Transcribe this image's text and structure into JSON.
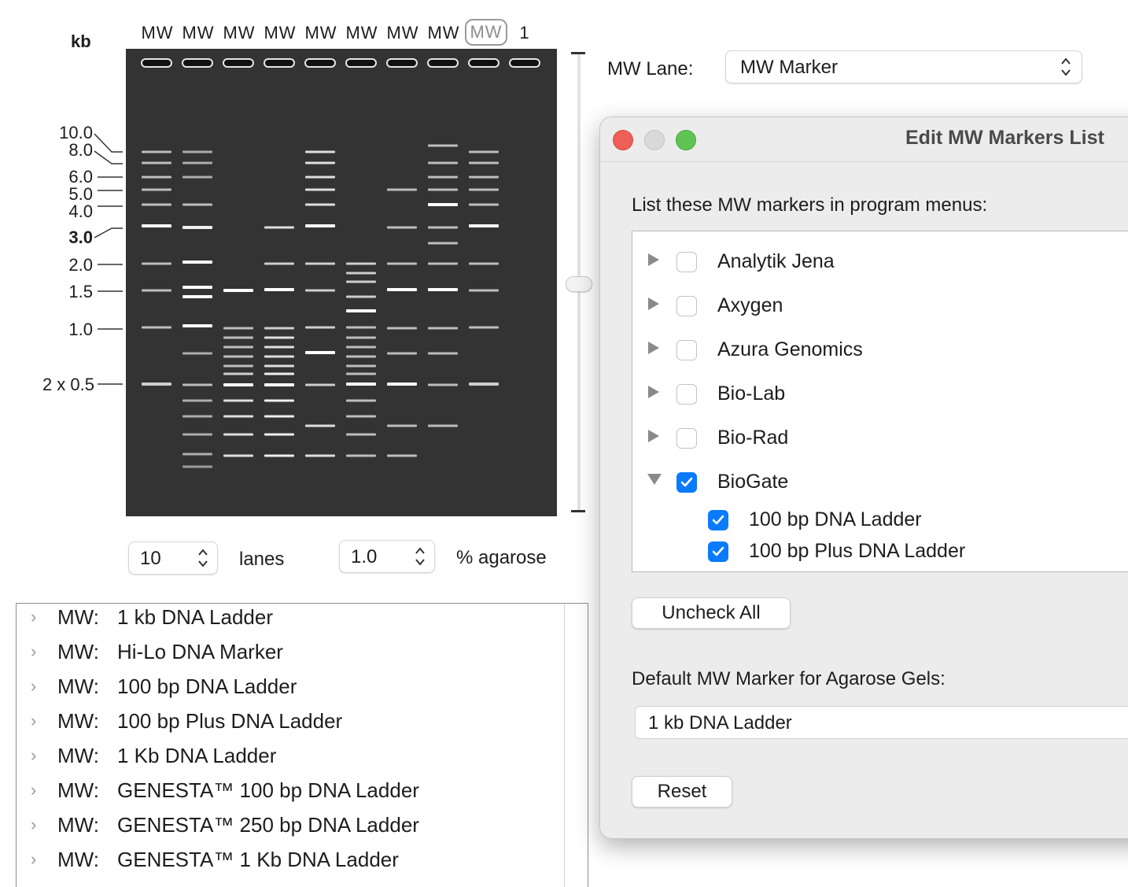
{
  "gel": {
    "axis_unit": "kb",
    "lane_headers": [
      "MW",
      "MW",
      "MW",
      "MW",
      "MW",
      "MW",
      "MW",
      "MW",
      "MW",
      "1"
    ],
    "selected_lane_index": 8,
    "size_ticks": [
      "10.0",
      "8.0",
      "6.0",
      "5.0",
      "4.0",
      "3.0",
      "2.0",
      "1.5",
      "1.0",
      "2 x 0.5"
    ],
    "bold_tick": "3.0",
    "lanes_count": "10",
    "lanes_label": "lanes",
    "agarose": "1.0",
    "agarose_label": "% agarose"
  },
  "mw_lane": {
    "label": "MW Lane:",
    "value": "MW Marker"
  },
  "marker_list": {
    "prefix": "MW:",
    "items": [
      "1 kb DNA Ladder",
      "Hi-Lo DNA Marker",
      "100 bp DNA Ladder",
      "100 bp Plus DNA Ladder",
      "1 Kb DNA Ladder",
      "GENESTA™ 100 bp DNA Ladder",
      "GENESTA™ 250 bp DNA Ladder",
      "GENESTA™ 1 Kb DNA Ladder"
    ]
  },
  "dialog": {
    "title": "Edit MW Markers List",
    "list_label": "List these MW markers in program menus:",
    "vendors": [
      {
        "name": "Analytik Jena",
        "checked": false,
        "expanded": false
      },
      {
        "name": "Axygen",
        "checked": false,
        "expanded": false
      },
      {
        "name": "Azura Genomics",
        "checked": false,
        "expanded": false
      },
      {
        "name": "Bio-Lab",
        "checked": false,
        "expanded": false
      },
      {
        "name": "Bio-Rad",
        "checked": false,
        "expanded": false
      },
      {
        "name": "BioGate",
        "checked": true,
        "expanded": true
      }
    ],
    "sub_items": [
      {
        "name": "100 bp DNA Ladder",
        "checked": true
      },
      {
        "name": "100 bp Plus DNA Ladder",
        "checked": true
      }
    ],
    "uncheck_all": "Uncheck All",
    "default_label": "Default MW Marker for Agarose Gels:",
    "default_value": "1 kb DNA Ladder",
    "reset": "Reset"
  },
  "colors": {
    "gel_background": "#333333",
    "checkbox_accent": "#0a7aff",
    "close": "#ee5f57",
    "minimize": "#d9d9d9",
    "zoom": "#5fc453"
  }
}
